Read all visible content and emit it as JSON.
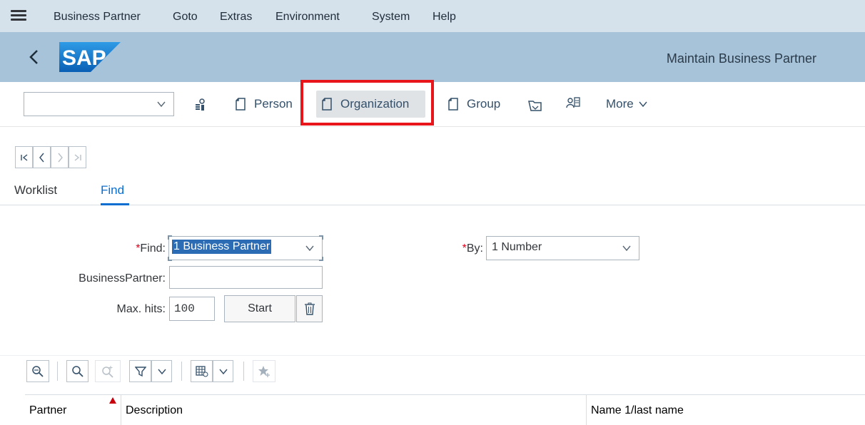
{
  "menubar": {
    "items": [
      "Business Partner",
      "Goto",
      "Extras",
      "Environment",
      "System",
      "Help"
    ]
  },
  "titlebar": {
    "logo_text": "SAP",
    "title": "Maintain Business Partner"
  },
  "toolbar": {
    "combo_value": "",
    "buttons": {
      "person": "Person",
      "organization": "Organization",
      "group": "Group",
      "more": "More"
    }
  },
  "locator": {
    "tabs": [
      "Worklist",
      "Find"
    ],
    "active_tab": "Find"
  },
  "form": {
    "find_label": "Find:",
    "find_value": "1 Business Partner",
    "by_label": "By:",
    "by_value": "1 Number",
    "bp_label": "BusinessPartner:",
    "bp_value": "",
    "maxhits_label": "Max. hits:",
    "maxhits_value": "100",
    "start_label": "Start",
    "required_mark": "*"
  },
  "table": {
    "columns": [
      "Partner",
      "Description",
      "Name 1/last name"
    ],
    "sorted_column": "Partner"
  },
  "colors": {
    "menubar_bg": "#d5e2ec",
    "titlebar_bg": "#a6c3d9",
    "highlight": "#e8151b",
    "accent": "#0a6ed1",
    "sap_blue": "#1b7bd4"
  }
}
